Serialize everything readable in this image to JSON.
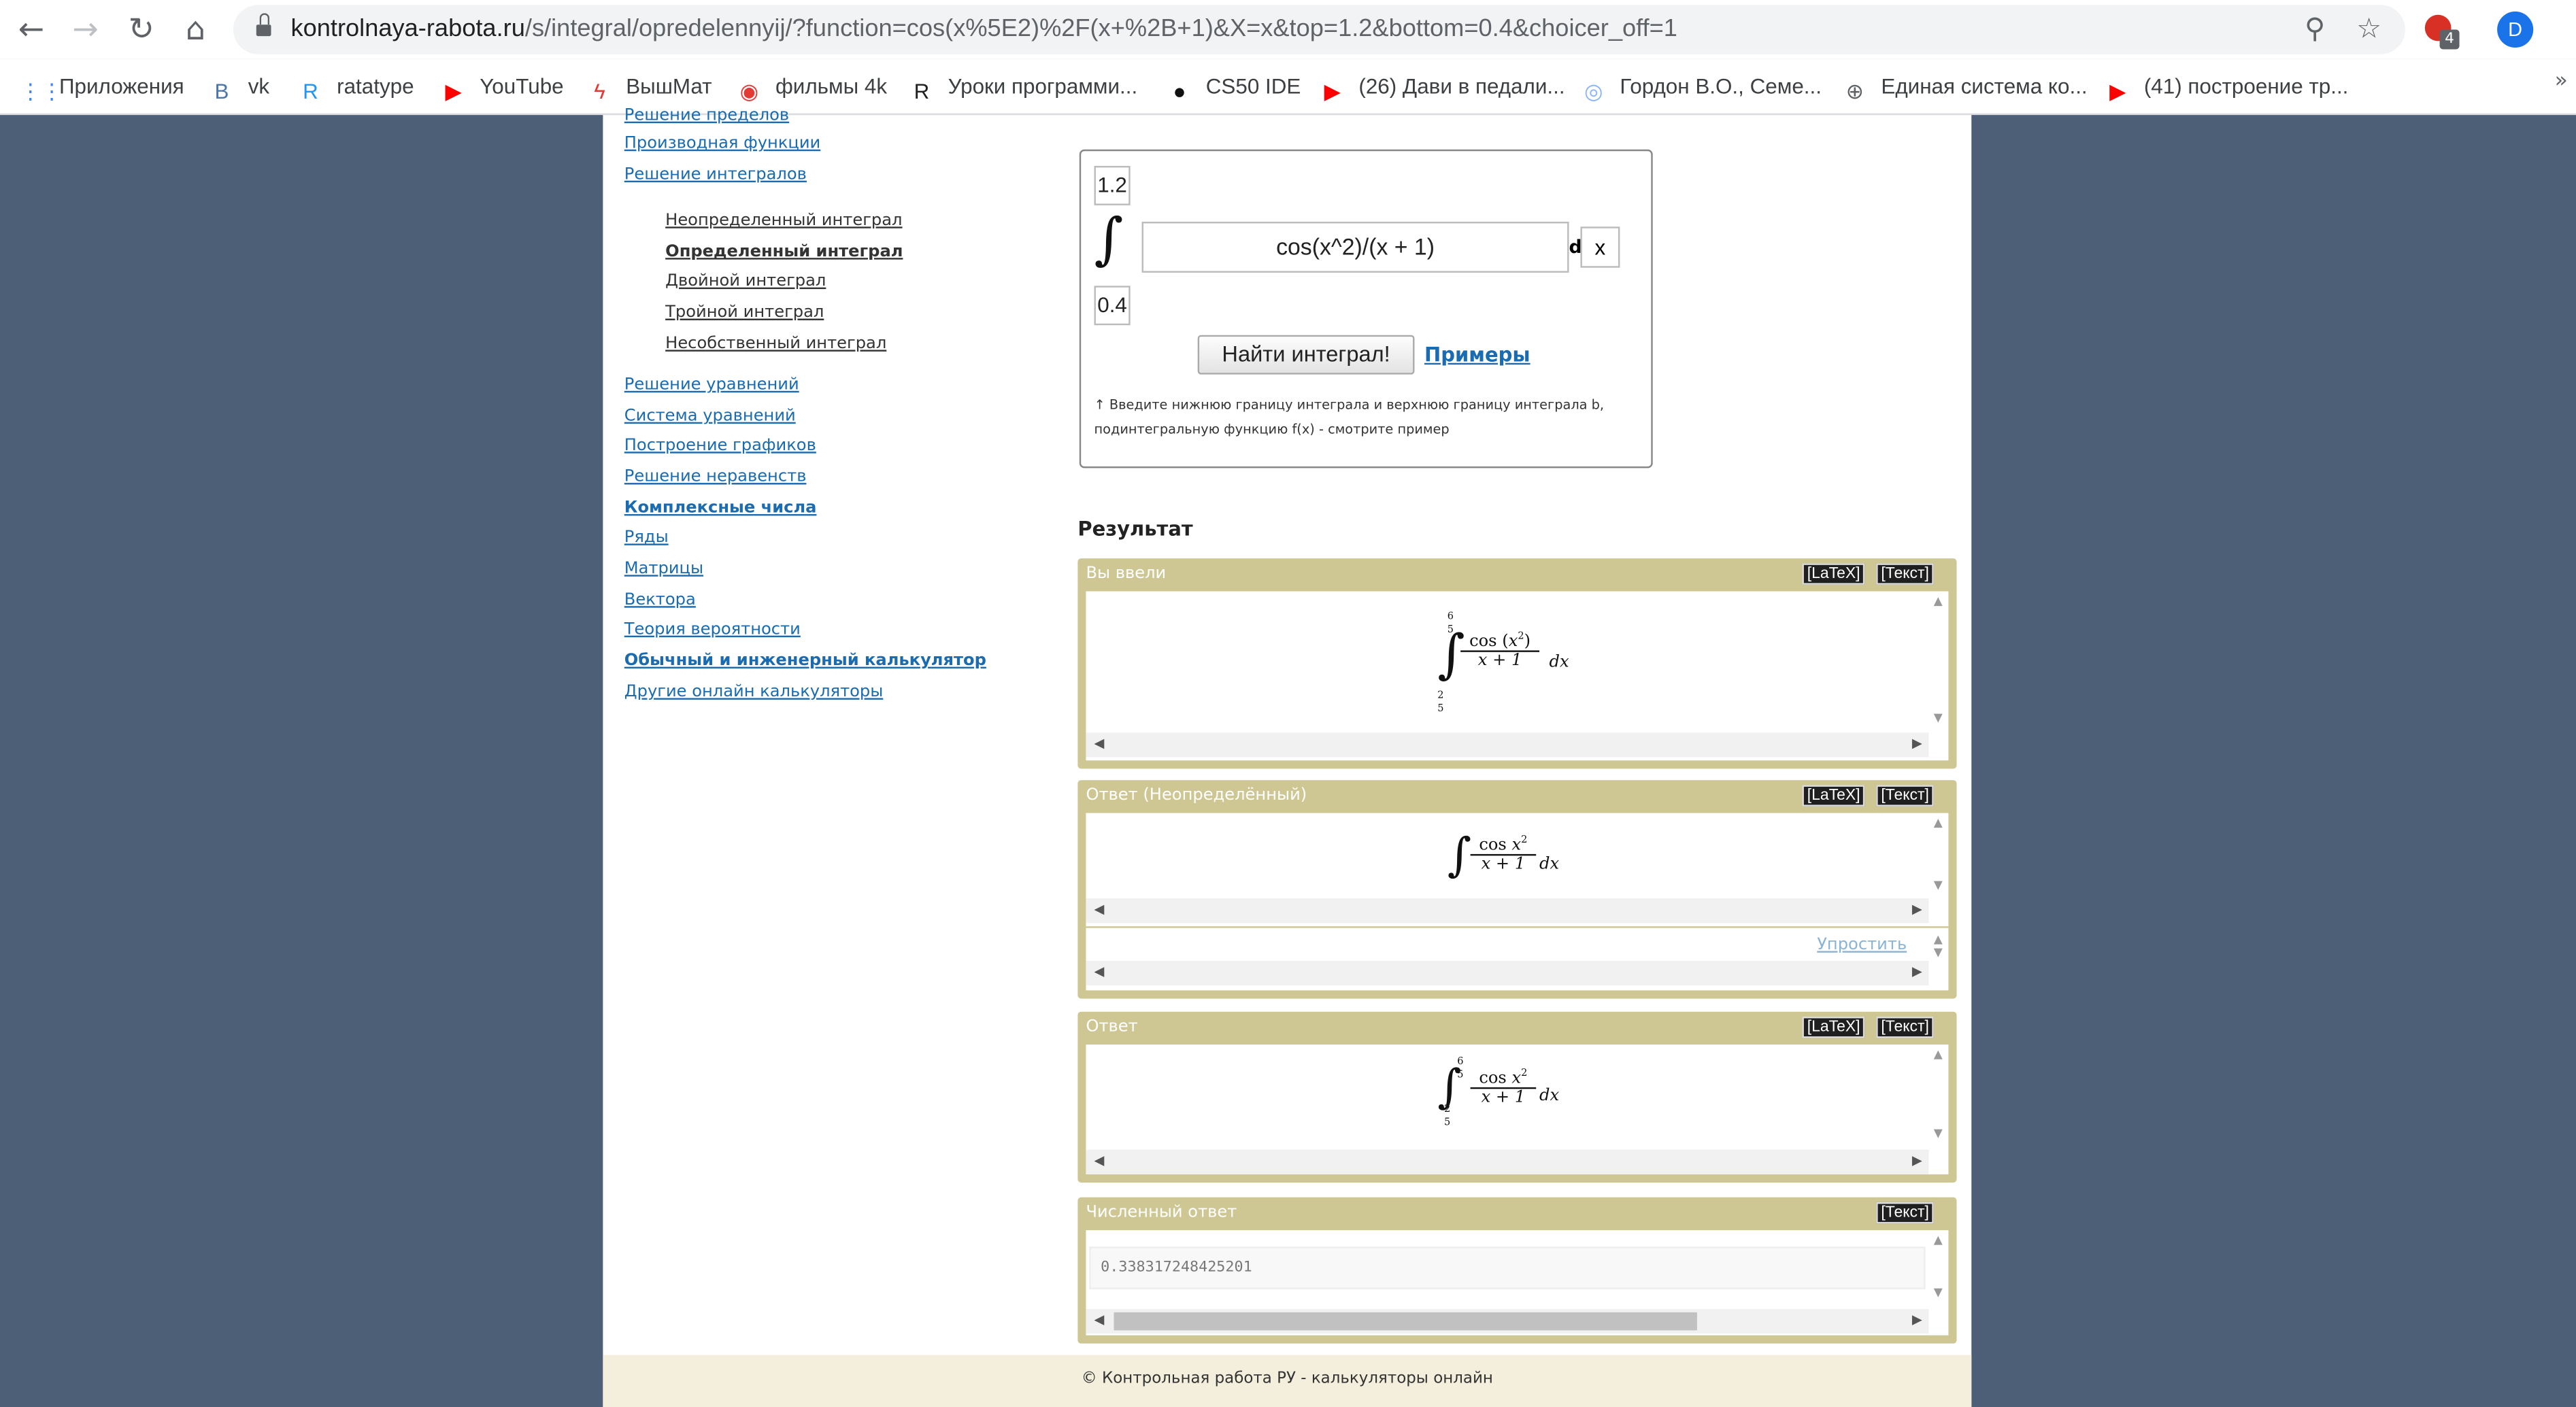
{
  "browser": {
    "url_host": "kontrolnaya-rabota.ru",
    "url_rest": "/s/integral/opredelennyij/?function=cos(x%5E2)%2F(x+%2B+1)&X=x&top=1.2&bottom=0.4&choicer_off=1",
    "ext_badge": "4",
    "avatar_letter": "D",
    "bookmarks": [
      {
        "label": "Приложения",
        "icon": "apps-grid-icon",
        "color": "#4285f4"
      },
      {
        "label": "vk",
        "icon": "vk-icon",
        "color": "#4a76a8"
      },
      {
        "label": "ratatype",
        "icon": "ratatype-icon",
        "color": "#2196f3"
      },
      {
        "label": "YouTube",
        "icon": "youtube-icon",
        "color": "#ff0000"
      },
      {
        "label": "ВышМат",
        "icon": "lightning-icon",
        "color": "#e53935"
      },
      {
        "label": "фильмы 4k",
        "icon": "film-icon",
        "color": "#e53935"
      },
      {
        "label": "Уроки программи...",
        "icon": "r-letter-icon",
        "color": "#222222"
      },
      {
        "label": "CS50 IDE",
        "icon": "github-icon",
        "color": "#111111"
      },
      {
        "label": "(26) Дави в педали...",
        "icon": "youtube-icon",
        "color": "#ff0000"
      },
      {
        "label": "Гордон В.О., Семе...",
        "icon": "podcast-icon",
        "color": "#8ab4f8"
      },
      {
        "label": "Единая система ко...",
        "icon": "globe-icon",
        "color": "#5f6368"
      },
      {
        "label": "(41) построение тр...",
        "icon": "youtube-icon",
        "color": "#ff0000"
      }
    ]
  },
  "sidebar": {
    "cut_top": "Решение пределов",
    "links": [
      "Производная функции",
      "Решение интегралов"
    ],
    "sublinks": [
      "Неопределенный интеграл",
      "Определенный интеграл",
      "Двойной интеграл",
      "Тройной интеграл",
      "Несобственный интеграл"
    ],
    "links2": [
      "Решение уравнений",
      "Система уравнений",
      "Построение графиков",
      "Решение неравенств",
      "Комплексные числа",
      "Ряды",
      "Матрицы",
      "Вектора",
      "Теория вероятности",
      "Обычный и инженерный калькулятор",
      "Другие онлайн калькуляторы"
    ]
  },
  "calc": {
    "top": "1.2",
    "bottom": "0.4",
    "function": "cos(x^2)/(x + 1)",
    "d_label": "d",
    "variable": "x",
    "submit": "Найти интеграл!",
    "examples": "Примеры",
    "hint": "↑ Введите нижнюю границу интеграла и верхнюю границу интеграла b, подинтегральную функцию f(x) - смотрите пример"
  },
  "result": {
    "heading": "Результат",
    "latex": "[LaTeX]",
    "text": "[Текст]",
    "panels": {
      "entered": "Вы ввели",
      "indefinite": "Ответ (Неопределённый)",
      "answer": "Ответ",
      "numeric": "Численный ответ"
    },
    "simplify": "Упростить",
    "numeric_value": "0.338317248425201",
    "math": {
      "cos": "cos",
      "x": "x",
      "two": "2",
      "plus1": "x + 1",
      "dx": "dx",
      "six": "6",
      "five": "5",
      "lparen": "(",
      "rparen": ")"
    }
  },
  "footer": "© Контрольная работа РУ - калькуляторы онлайн"
}
